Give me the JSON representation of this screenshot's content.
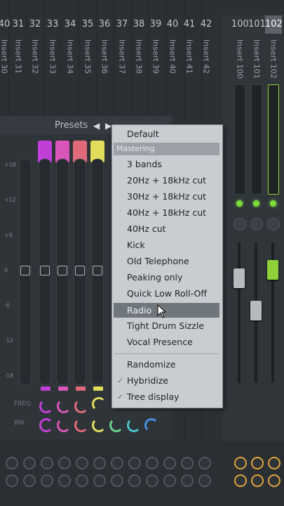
{
  "mixer": {
    "track_numbers": [
      "40",
      "31",
      "32",
      "33",
      "34",
      "35",
      "36",
      "37",
      "38",
      "39",
      "40",
      "41",
      "42"
    ],
    "right_numbers": [
      "100",
      "101",
      "102"
    ],
    "insert_labels": [
      "Insert 30",
      "Insert 31",
      "Insert 32",
      "Insert 33",
      "Insert 34",
      "Insert 35",
      "Insert 36",
      "Insert 37",
      "Insert 38",
      "Insert 39",
      "Insert 40",
      "Insert 41",
      "Insert 42"
    ],
    "right_insert_labels": [
      "Insert 100",
      "Insert 101",
      "Insert 102"
    ],
    "selected_track": "102"
  },
  "plugin": {
    "presets_label": "Presets",
    "prev_arrow": "◀",
    "next_arrow": "▶",
    "scale": [
      "+18",
      "+12",
      "+6",
      "0",
      "-6",
      "-12",
      "-18"
    ],
    "freq_label": "FREQ",
    "bw_label": "BW",
    "band_colors": [
      "#c13fd6",
      "#d955b9",
      "#e06a7a",
      "#e2dc5b"
    ]
  },
  "preset_menu": {
    "default": "Default",
    "section_header": "Mastering",
    "items": [
      "3 bands",
      "20Hz + 18kHz cut",
      "30Hz + 18kHz cut",
      "40Hz + 18kHz cut",
      "40Hz cut",
      "Kick",
      "Old Telephone",
      "Peaking only",
      "Quick Low Roll-Off",
      "Radio",
      "Tight Drum Sizzle",
      "Vocal Presence"
    ],
    "selected_item": "Radio",
    "options": [
      "Randomize",
      "Hybridize",
      "Tree display"
    ],
    "checked_options": [
      "Hybridize",
      "Tree display"
    ],
    "check_glyph": "✓"
  }
}
